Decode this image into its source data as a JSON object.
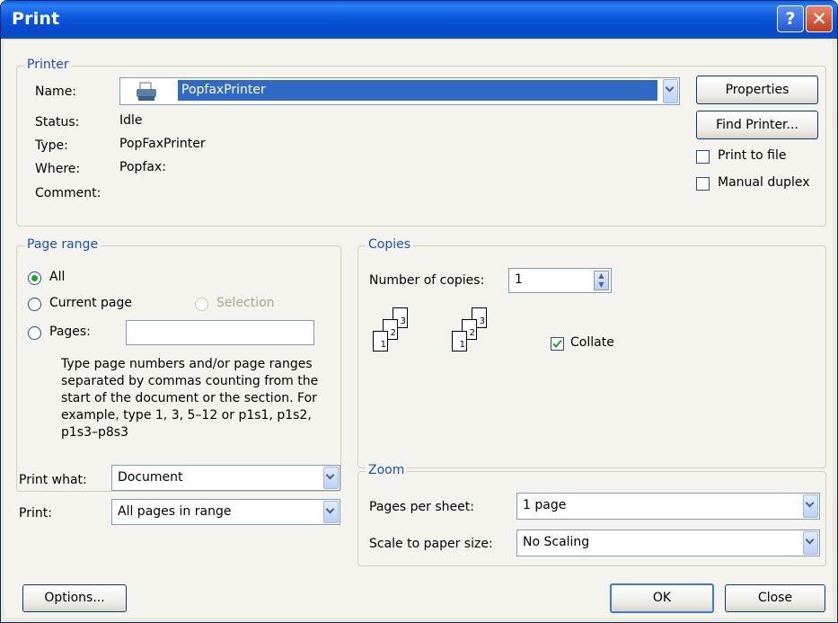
{
  "title": "Print",
  "titlebar": {
    "help": "?",
    "close": "✕"
  },
  "printer": {
    "legend": "Printer",
    "name_label": "Name:",
    "name_value": "PopfaxPrinter",
    "status_label": "Status:",
    "status_value": "Idle",
    "type_label": "Type:",
    "type_value": "PopFaxPrinter",
    "where_label": "Where:",
    "where_value": "Popfax:",
    "comment_label": "Comment:",
    "comment_value": "",
    "properties_button": "Properties",
    "find_printer_button": "Find Printer...",
    "print_to_file": "Print to file",
    "manual_duplex": "Manual duplex"
  },
  "page_range": {
    "legend": "Page range",
    "all": "All",
    "current_page": "Current page",
    "selection": "Selection",
    "pages": "Pages:",
    "pages_value": "",
    "help_text": "Type page numbers and/or page ranges separated by commas counting from the start of the document or the section. For example, type 1, 3, 5–12 or p1s1, p1s2, p1s3–p8s3"
  },
  "copies": {
    "legend": "Copies",
    "number_label": "Number of copies:",
    "number_value": "1",
    "collate": "Collate",
    "page_labels": [
      "3",
      "2",
      "1"
    ]
  },
  "print_what": {
    "label": "Print what:",
    "value": "Document"
  },
  "print": {
    "label": "Print:",
    "value": "All pages in range"
  },
  "zoom": {
    "legend": "Zoom",
    "pages_per_sheet_label": "Pages per sheet:",
    "pages_per_sheet_value": "1 page",
    "scale_label": "Scale to paper size:",
    "scale_value": "No Scaling"
  },
  "footer": {
    "options": "Options...",
    "ok": "OK",
    "close": "Close"
  }
}
